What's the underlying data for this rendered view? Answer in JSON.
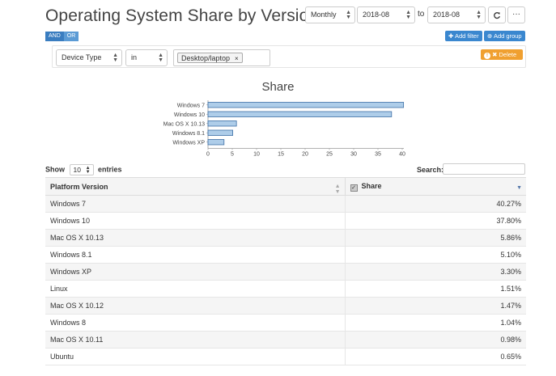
{
  "header": {
    "title": "Operating System Share by Version",
    "period": "Monthly",
    "date_from": "2018-08",
    "to_label": "to",
    "date_to": "2018-08",
    "refresh_icon": "refresh-icon",
    "more_icon": "ellipsis-icon",
    "more_label": "···"
  },
  "filters": {
    "and_label": "AND",
    "or_label": "OR",
    "add_filter_label": "Add filter",
    "add_group_label": "Add group",
    "delete_label": "Delete",
    "field": "Device Type",
    "operator": "in",
    "value_tag": "Desktop/laptop",
    "remove_tag_label": "×"
  },
  "chart_data": {
    "type": "bar",
    "orientation": "horizontal",
    "title": "Share",
    "categories": [
      "Windows 7",
      "Windows 10",
      "Mac OS X 10.13",
      "Windows 8.1",
      "Windows XP"
    ],
    "values": [
      40.27,
      37.8,
      5.86,
      5.1,
      3.3
    ],
    "xlim": [
      0,
      40
    ],
    "xticks": [
      "0",
      "5",
      "10",
      "15",
      "20",
      "25",
      "30",
      "35",
      "40"
    ],
    "bar_color": "#aecde9",
    "bar_stroke": "#3d6fa6"
  },
  "table": {
    "show_label": "Show",
    "entries_value": "10",
    "entries_label": "entries",
    "search_label": "Search:",
    "columns": [
      "Platform Version",
      "Share"
    ],
    "rows": [
      [
        "Windows 7",
        "40.27%"
      ],
      [
        "Windows 10",
        "37.80%"
      ],
      [
        "Mac OS X 10.13",
        "5.86%"
      ],
      [
        "Windows 8.1",
        "5.10%"
      ],
      [
        "Windows XP",
        "3.30%"
      ],
      [
        "Linux",
        "1.51%"
      ],
      [
        "Mac OS X 10.12",
        "1.47%"
      ],
      [
        "Windows 8",
        "1.04%"
      ],
      [
        "Mac OS X 10.11",
        "0.98%"
      ],
      [
        "Ubuntu",
        "0.65%"
      ]
    ]
  }
}
